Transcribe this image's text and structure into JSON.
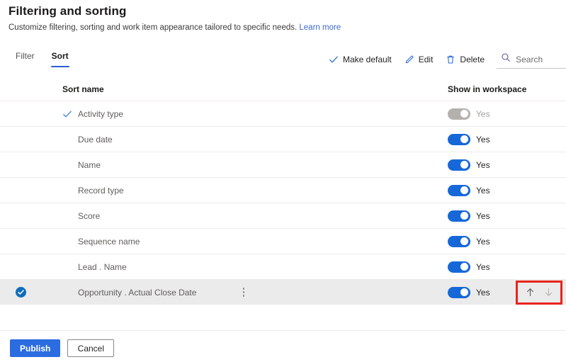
{
  "header": {
    "title": "Filtering and sorting",
    "subtitle": "Customize filtering, sorting and work item appearance tailored to specific needs.",
    "learn_more": "Learn more"
  },
  "tabs": [
    {
      "label": "Filter",
      "active": false
    },
    {
      "label": "Sort",
      "active": true
    }
  ],
  "commandbar": {
    "make_default": "Make default",
    "edit": "Edit",
    "delete": "Delete",
    "search_placeholder": "Search",
    "search_value": ""
  },
  "table": {
    "columns": {
      "sort_name": "Sort name",
      "show_in_workspace": "Show in workspace"
    },
    "rows": [
      {
        "name": "Activity type",
        "default": true,
        "toggle_on": false,
        "toggle_label": "Yes",
        "toggle_disabled": true,
        "selected": false
      },
      {
        "name": "Due date",
        "default": false,
        "toggle_on": true,
        "toggle_label": "Yes",
        "toggle_disabled": false,
        "selected": false
      },
      {
        "name": "Name",
        "default": false,
        "toggle_on": true,
        "toggle_label": "Yes",
        "toggle_disabled": false,
        "selected": false
      },
      {
        "name": "Record type",
        "default": false,
        "toggle_on": true,
        "toggle_label": "Yes",
        "toggle_disabled": false,
        "selected": false
      },
      {
        "name": "Score",
        "default": false,
        "toggle_on": true,
        "toggle_label": "Yes",
        "toggle_disabled": false,
        "selected": false
      },
      {
        "name": "Sequence name",
        "default": false,
        "toggle_on": true,
        "toggle_label": "Yes",
        "toggle_disabled": false,
        "selected": false
      },
      {
        "name": "Lead . Name",
        "default": false,
        "toggle_on": true,
        "toggle_label": "Yes",
        "toggle_disabled": false,
        "selected": false
      },
      {
        "name": "Opportunity . Actual Close Date",
        "default": false,
        "toggle_on": true,
        "toggle_label": "Yes",
        "toggle_disabled": false,
        "selected": true
      }
    ]
  },
  "reorder": {
    "move_up": "move-up",
    "move_down": "move-down",
    "highlight_color": "#e8241c"
  },
  "footer": {
    "publish": "Publish",
    "cancel": "Cancel"
  },
  "colors": {
    "accent": "#2b6ce0",
    "link": "#3b6ccc",
    "toggle_on": "#1668d9",
    "toggle_off": "#b3b0ad",
    "checkbox": "#0f6cbd",
    "selected_row": "#ebebeb"
  }
}
